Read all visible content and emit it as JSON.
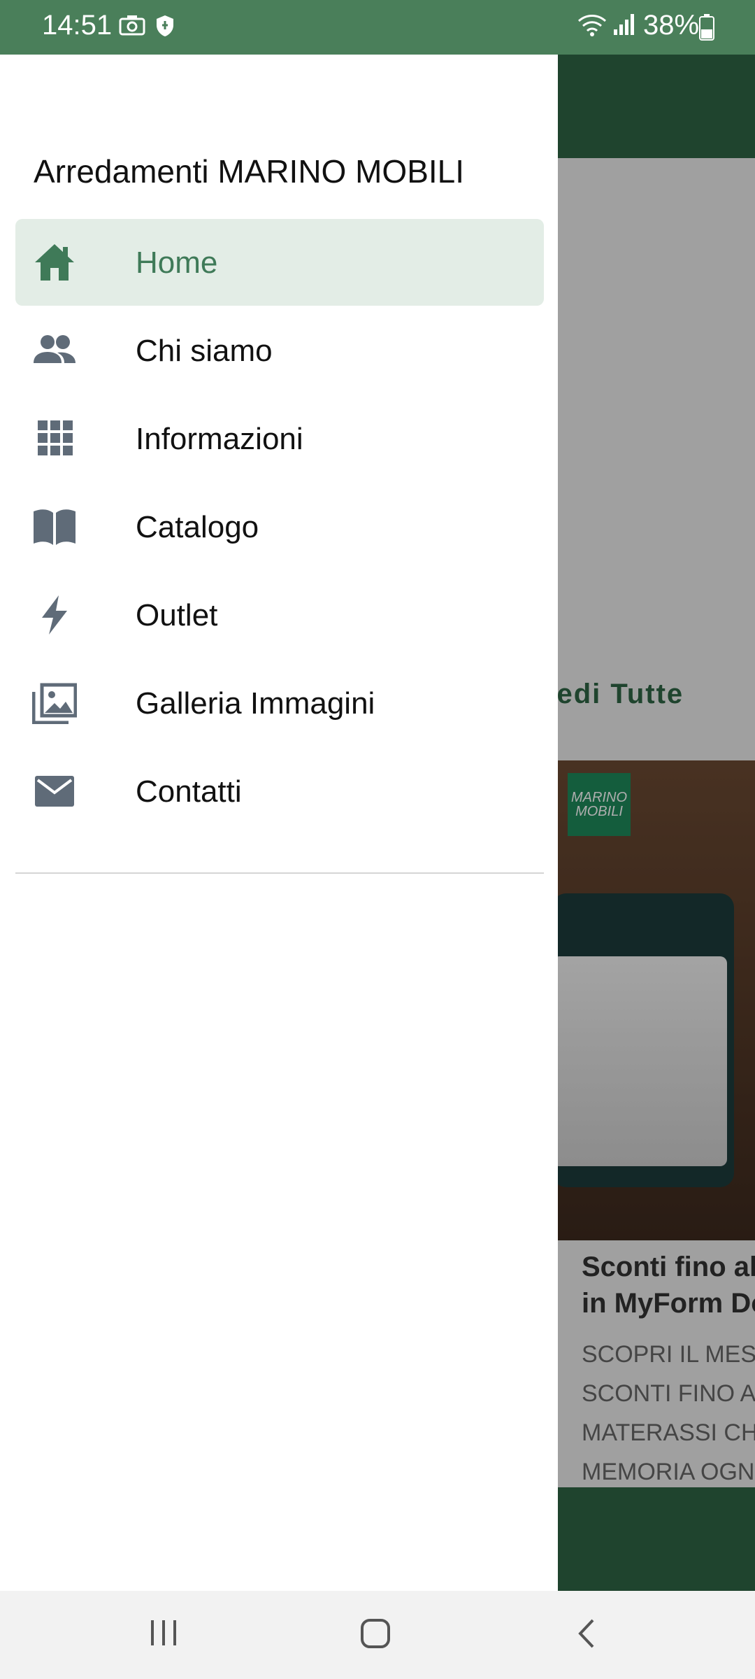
{
  "status_bar": {
    "time": "14:51",
    "battery_percent": "38%",
    "icons": [
      "camera-icon",
      "shield-icon",
      "wifi-icon",
      "signal-icon",
      "battery-icon"
    ]
  },
  "drawer": {
    "header": "Arredamenti MARINO MOBILI",
    "items": [
      {
        "label": "Home",
        "icon": "home-icon",
        "active": true
      },
      {
        "label": "Chi siamo",
        "icon": "people-icon",
        "active": false
      },
      {
        "label": "Informazioni",
        "icon": "grid-icon",
        "active": false
      },
      {
        "label": "Catalogo",
        "icon": "book-icon",
        "active": false
      },
      {
        "label": "Outlet",
        "icon": "lightning-icon",
        "active": false
      },
      {
        "label": "Galleria Immagini",
        "icon": "gallery-icon",
        "active": false
      },
      {
        "label": "Contatti",
        "icon": "mail-icon",
        "active": false
      }
    ]
  },
  "background_app": {
    "see_all_label": "Vedi Tutte",
    "promo": {
      "logo_text_1": "MARINO",
      "logo_text_2": "MOBILI",
      "title_line1": "Sconti fino al",
      "title_line2": "in MyForm Do",
      "text_lines": [
        "SCOPRI IL MES",
        "SCONTI FINO A",
        "MATERASSI CH",
        "MEMORIA OGN"
      ]
    }
  },
  "colors": {
    "primary": "#2e6544",
    "status_bar": "#4a7f5a",
    "active_item_bg": "#e3ede6",
    "active_item_text": "#3f7a58",
    "icon_gray": "#5f6b78"
  },
  "nav_bar": {
    "buttons": [
      "recents-button",
      "home-button",
      "back-button"
    ]
  }
}
